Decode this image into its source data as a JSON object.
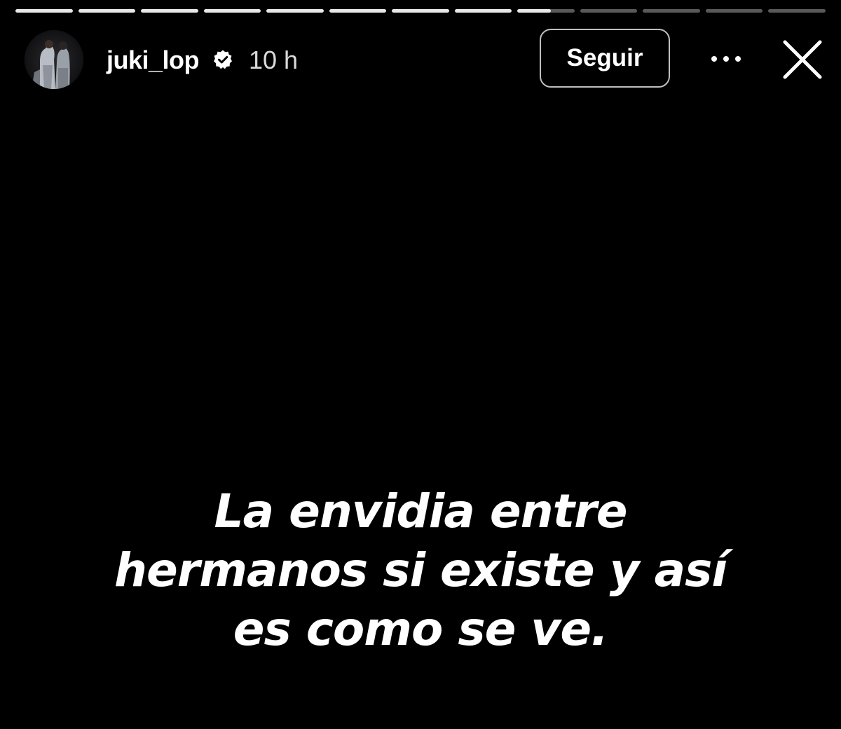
{
  "story": {
    "progress_segments": 13,
    "progress_fraction": 0.66,
    "lines": [
      "La envidia entre",
      "hermanos si existe y así",
      "es como se ve."
    ]
  },
  "header": {
    "username": "juki_lop",
    "time": "10 h",
    "follow_label": "Seguir",
    "verified_icon": "verified-badge-icon",
    "more_icon": "more-options-icon",
    "close_icon": "close-icon"
  },
  "colors": {
    "background": "#000000",
    "text": "#ffffff",
    "progress_track": "rgba(255,255,255,0.35)",
    "progress_fill": "#e8e8e8"
  }
}
